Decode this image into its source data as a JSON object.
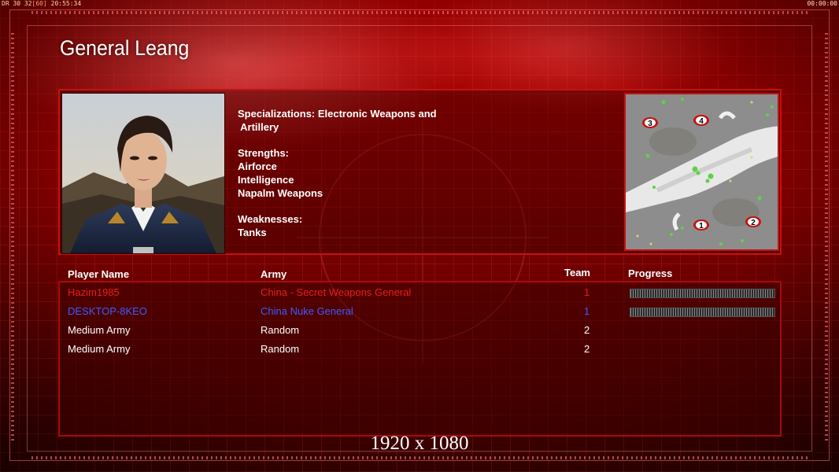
{
  "hud": {
    "left_prefix": "DR 30 32",
    "left_bracket": "[60]",
    "left_time": "20:55:34",
    "right_time": "00:00:00"
  },
  "general": {
    "name": "General Leang",
    "specializations_label": "Specializations: Electronic Weapons and",
    "specializations_cont": " Artillery",
    "strengths_label": "Strengths:",
    "strengths": [
      "Airforce",
      "Intelligence",
      "Napalm Weapons"
    ],
    "weaknesses_label": "Weaknesses:",
    "weaknesses": [
      "Tanks"
    ]
  },
  "minimap": {
    "start_positions": [
      "1",
      "2",
      "3",
      "4"
    ]
  },
  "table": {
    "headers": {
      "player": "Player Name",
      "army": "Army",
      "team": "Team",
      "progress": "Progress"
    },
    "rows": [
      {
        "name": "Hazim1985",
        "army": "China - Secret Weapons General",
        "team": "1",
        "color": "#e61e1e",
        "progress": 1.0
      },
      {
        "name": "DESKTOP-8KEO",
        "army": "China Nuke General",
        "team": "1",
        "color": "#3c5cff",
        "progress": 1.0
      },
      {
        "name": "Medium Army",
        "army": "Random",
        "team": "2",
        "color": "#ffffff"
      },
      {
        "name": "Medium Army",
        "army": "Random",
        "team": "2",
        "color": "#ffffff"
      }
    ]
  },
  "resolution": "1920 x 1080",
  "colors": {
    "frame": "#c41212"
  }
}
